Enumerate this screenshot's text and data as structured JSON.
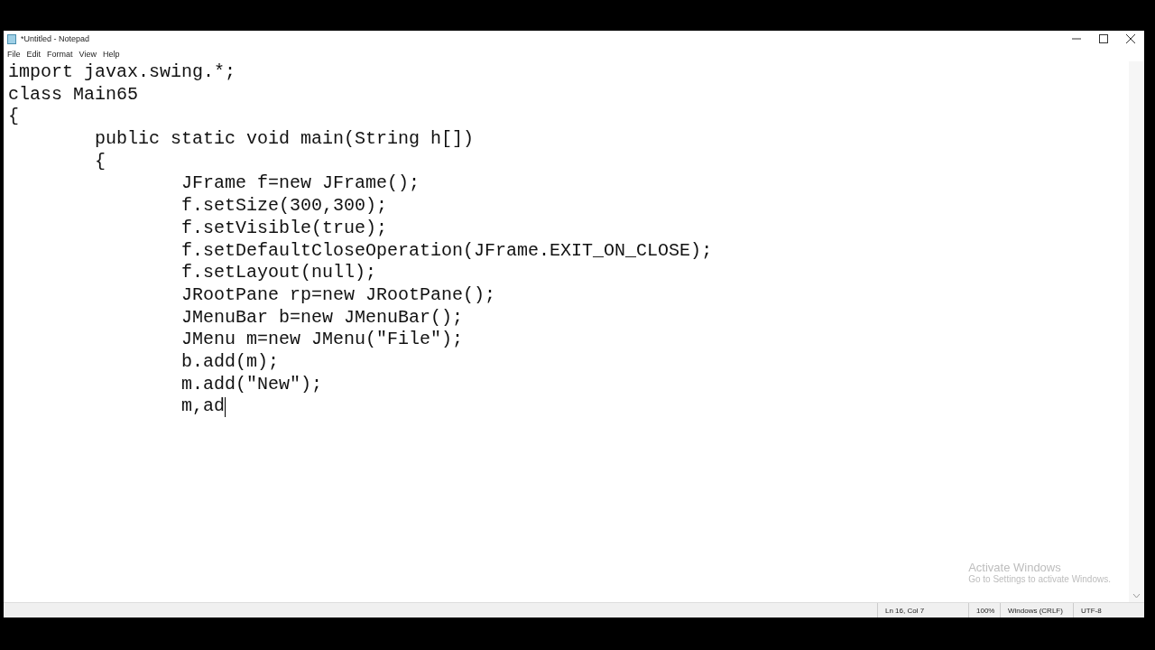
{
  "window": {
    "title": "*Untitled - Notepad"
  },
  "menu": [
    "File",
    "Edit",
    "Format",
    "View",
    "Help"
  ],
  "editor": {
    "lines": [
      "import javax.swing.*;",
      "class Main65",
      "{",
      "\tpublic static void main(String h[])",
      "\t{",
      "\t\tJFrame f=new JFrame();",
      "\t\tf.setSize(300,300);",
      "\t\tf.setVisible(true);",
      "\t\tf.setDefaultCloseOperation(JFrame.EXIT_ON_CLOSE);",
      "\t\tf.setLayout(null);",
      "\t\tJRootPane rp=new JRootPane();",
      "\t\tJMenuBar b=new JMenuBar();",
      "\t\tJMenu m=new JMenu(\"File\");",
      "\t\tb.add(m);",
      "\t\tm.add(\"New\");",
      "\t\tm,ad"
    ]
  },
  "activation": {
    "title": "Activate Windows",
    "hint": "Go to Settings to activate Windows."
  },
  "status_bar": [
    "Ln 16, Col 7",
    "100%",
    "Windows (CRLF)",
    "UTF-8"
  ]
}
